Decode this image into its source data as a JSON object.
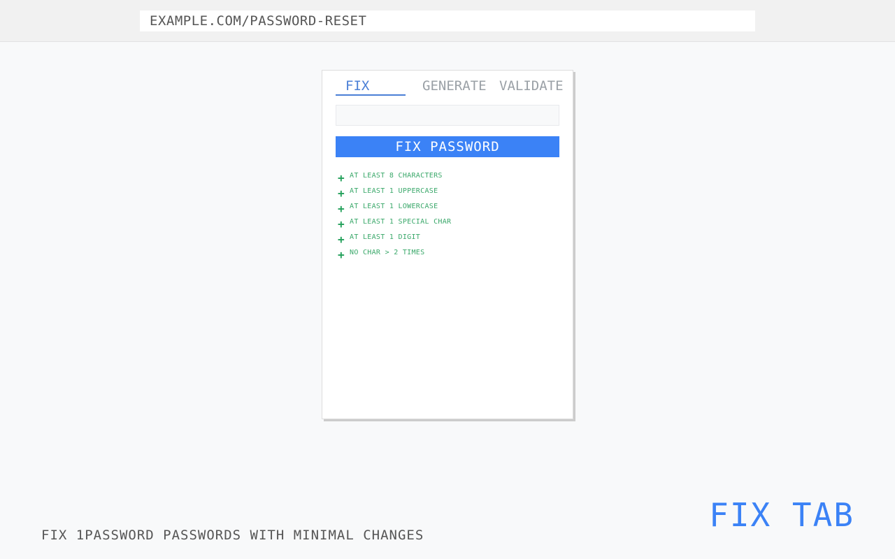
{
  "browser": {
    "url": "EXAMPLE.COM/PASSWORD-RESET"
  },
  "popup": {
    "tabs": [
      {
        "label": "FIX",
        "active": true
      },
      {
        "label": "GENERATE",
        "active": false
      },
      {
        "label": "VALIDATE",
        "active": false
      }
    ],
    "password_input": {
      "value": "",
      "placeholder": ""
    },
    "fix_button_label": "FIX PASSWORD",
    "rules": [
      {
        "icon": "plus-icon",
        "symbol": "+",
        "text": "AT LEAST 8 CHARACTERS"
      },
      {
        "icon": "plus-icon",
        "symbol": "+",
        "text": "AT LEAST 1 UPPERCASE"
      },
      {
        "icon": "plus-icon",
        "symbol": "+",
        "text": "AT LEAST 1 LOWERCASE"
      },
      {
        "icon": "plus-icon",
        "symbol": "+",
        "text": "AT LEAST 1 SPECIAL CHAR"
      },
      {
        "icon": "plus-icon",
        "symbol": "+",
        "text": "AT LEAST 1 DIGIT"
      },
      {
        "icon": "plus-icon",
        "symbol": "+",
        "text": "NO CHAR > 2 TIMES"
      }
    ]
  },
  "tagline": "FIX 1PASSWORD PASSWORDS WITH MINIMAL CHANGES",
  "caption": "FIX TAB",
  "colors": {
    "accent": "#3b82f6",
    "rule_ok": "#22a05a",
    "tab_inactive": "#9aa0a6"
  }
}
